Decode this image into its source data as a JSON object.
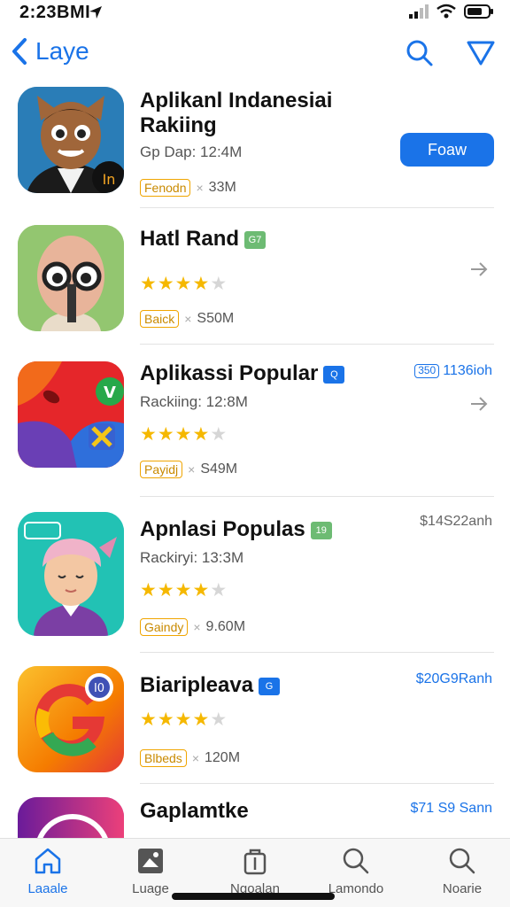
{
  "status": {
    "time": "2:23BMI"
  },
  "nav": {
    "back_label": "Laye",
    "search_icon": "search-icon",
    "filter_icon": "filter-icon"
  },
  "apps": [
    {
      "title_line1": "Aplikanl Indanesiai",
      "title_line2": "Rakiing",
      "subtitle": "Gp Dap: 12:4M",
      "tag": "Fenodn",
      "size": "33M",
      "action": "Foaw"
    },
    {
      "title": "Hatl Rand",
      "badge": "G7",
      "rating": 4.5,
      "tag": "Baick",
      "size": "S50M"
    },
    {
      "title": "Aplikassi Popular",
      "badge": "Q",
      "subtitle": "Rackiing: 12:8M",
      "rating": 4,
      "tag": "Payidj",
      "size": "S49M",
      "price_box": "350",
      "price": "1136ioh"
    },
    {
      "title": "Apnlasi Populas",
      "badge": "19",
      "subtitle": "Rackiryi: 13:3M",
      "rating": 4.5,
      "tag": "Gaindy",
      "size": "9.60M",
      "price": "$14S22anh"
    },
    {
      "title": "Biaripleava",
      "badge": "G",
      "rating": 4.5,
      "tag": "Blbeds",
      "size": "120M",
      "price": "$20G9Ranh"
    },
    {
      "title": "Gaplamtke",
      "price": "$71 S9 Sann"
    }
  ],
  "tabs": [
    {
      "label": "Laaale",
      "icon": "home-icon",
      "active": true
    },
    {
      "label": "Luage",
      "icon": "image-icon",
      "active": false
    },
    {
      "label": "Ngoalan",
      "icon": "bag-icon",
      "active": false
    },
    {
      "label": "Lamondo",
      "icon": "search-icon",
      "active": false
    },
    {
      "label": "Noarie",
      "icon": "search-icon",
      "active": false
    }
  ],
  "colors": {
    "accent": "#1a73e8",
    "star": "#f5b800",
    "tag": "#f0a500"
  }
}
